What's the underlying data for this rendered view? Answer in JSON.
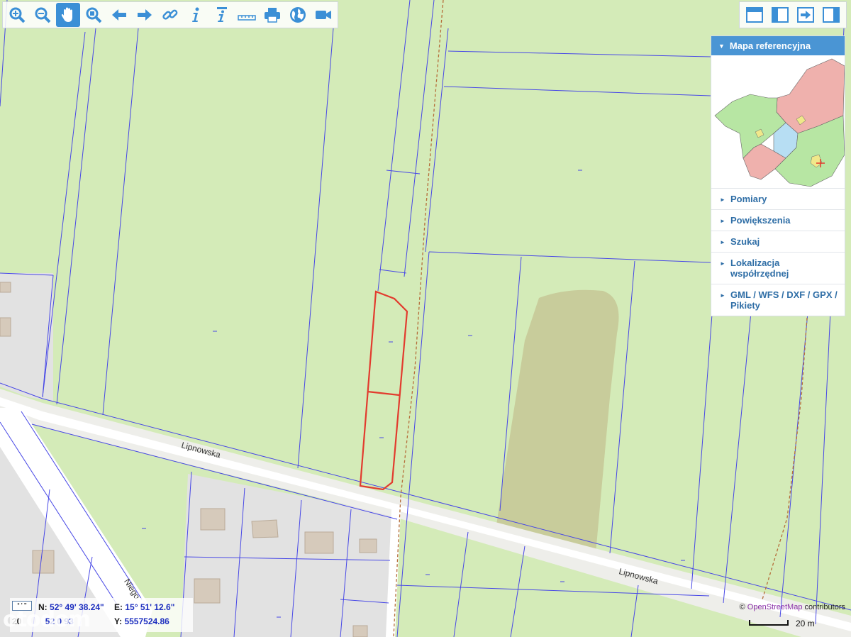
{
  "toolbar": {
    "tools": [
      {
        "name": "zoom-in-icon"
      },
      {
        "name": "zoom-out-icon"
      },
      {
        "name": "pan-hand-icon",
        "active": true
      },
      {
        "name": "zoom-window-icon"
      },
      {
        "name": "back-arrow-icon"
      },
      {
        "name": "forward-arrow-icon"
      },
      {
        "name": "link-icon"
      },
      {
        "name": "info-icon"
      },
      {
        "name": "info-extended-icon"
      },
      {
        "name": "ruler-icon"
      },
      {
        "name": "print-icon"
      },
      {
        "name": "globe-icon"
      },
      {
        "name": "video-camera-icon"
      }
    ]
  },
  "viewbar": {
    "buttons": [
      "layout-top-icon",
      "layout-left-icon",
      "export-icon",
      "layout-right-icon"
    ]
  },
  "panel": {
    "header": "Mapa referencyjna",
    "items": [
      "Pomiary",
      "Powiększenia",
      "Szukaj",
      "Lokalizacja współrzędnej",
      "GML / WFS / DXF / GPX / Pikiety"
    ]
  },
  "map": {
    "roads": [
      {
        "name": "Lipnowska"
      },
      {
        "name": "Lipnowska"
      },
      {
        "name": "Niego"
      }
    ]
  },
  "coords": {
    "n_label": "N:",
    "n_value": "52° 49' 38.24\"",
    "e_label": "E:",
    "e_value": "15° 51' 12.6\"",
    "x_prefix": "20",
    "x_value": "52  0 93",
    "y_label": "Y:",
    "y_value": "5557524.86"
  },
  "watermark": "otodom",
  "attribution": {
    "prefix": "©",
    "link": "OpenStreetMap",
    "suffix": "contributors"
  },
  "scale": {
    "label": "20 m"
  },
  "colors": {
    "parcel_fill": "#d4ebb8",
    "building_area": "#e1e1e1",
    "parcel_line": "#3a3ae0",
    "highlight": "#e23b2e",
    "road": "#ffffff",
    "forest": "#c9cf9f",
    "accent": "#4a95d4"
  }
}
